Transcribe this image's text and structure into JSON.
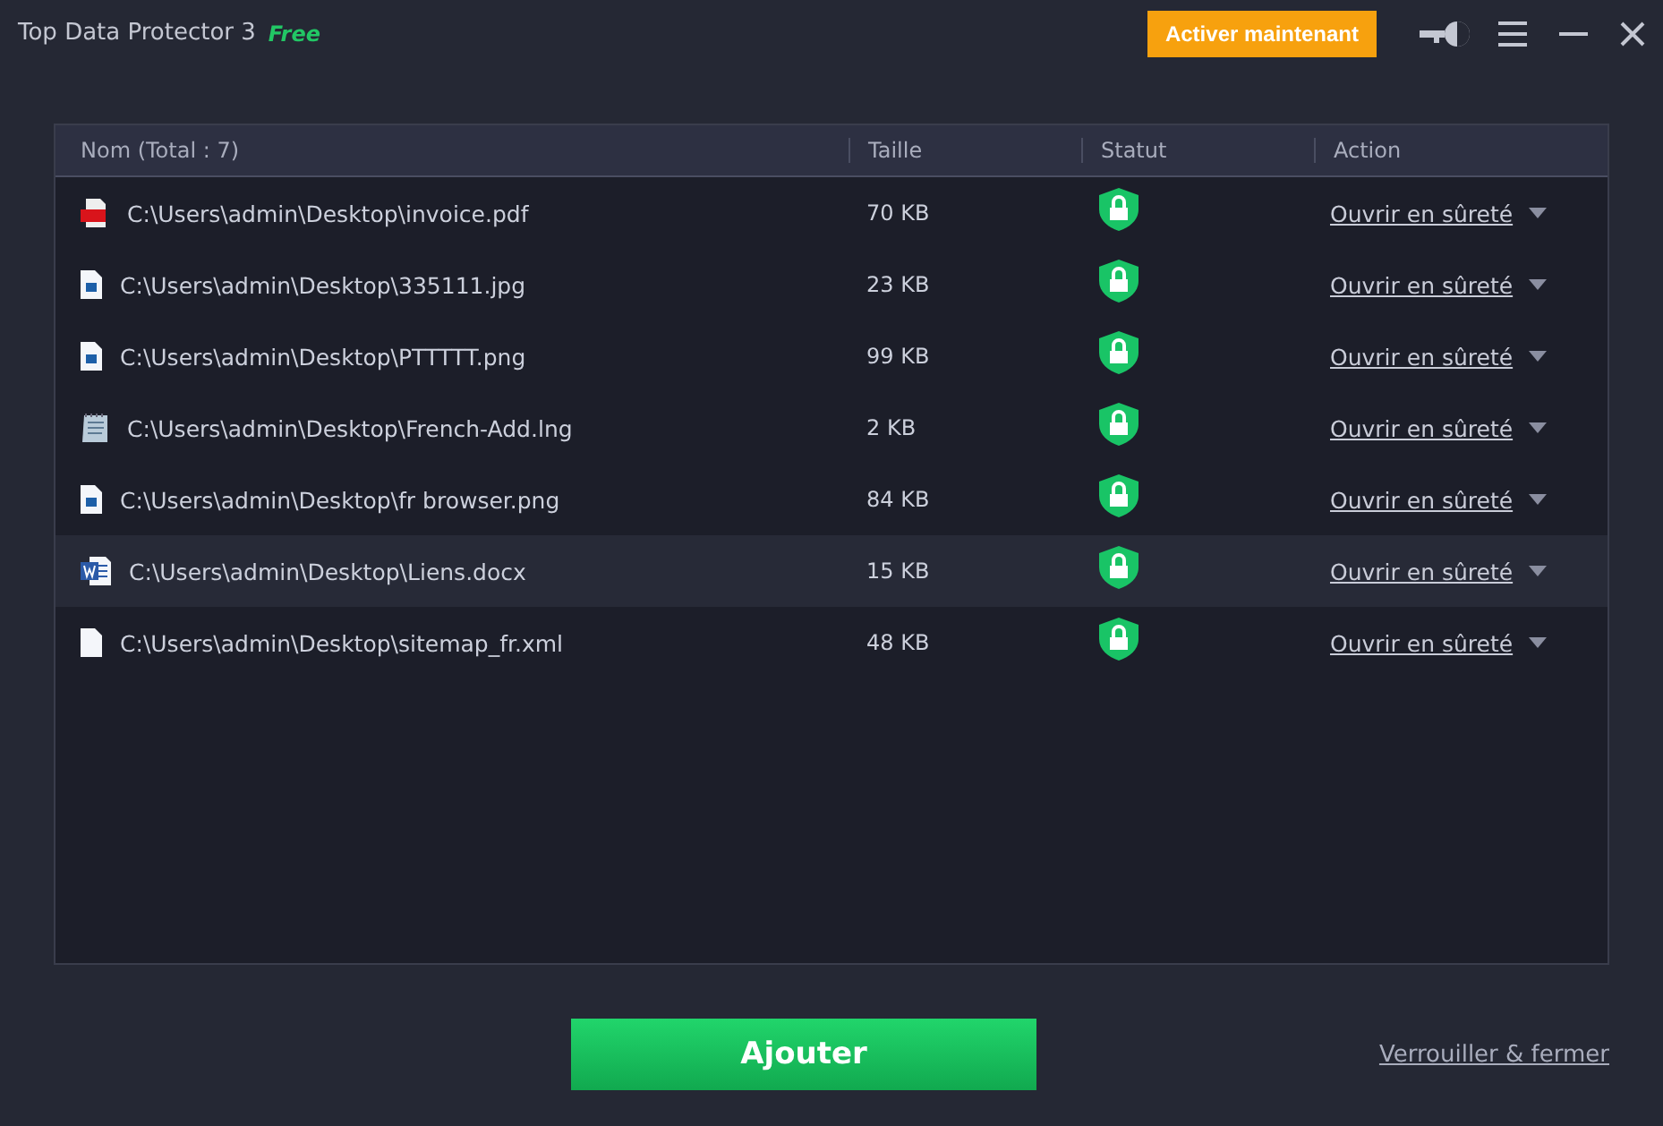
{
  "window": {
    "title": "Top Data Protector 3",
    "edition": "Free"
  },
  "toolbar": {
    "activate_button": "Activer maintenant"
  },
  "table": {
    "columns": [
      "Nom (Total : 7)",
      "Taille",
      "Statut",
      "Action"
    ],
    "rows": [
      {
        "kind": "pdf",
        "path": "C:\\Users\\admin\\Desktop\\invoice.pdf",
        "size": "70 KB",
        "locked": true,
        "action": "Ouvrir en sûreté",
        "selected": false
      },
      {
        "kind": "image",
        "path": "C:\\Users\\admin\\Desktop\\335111.jpg",
        "size": "23 KB",
        "locked": true,
        "action": "Ouvrir en sûreté",
        "selected": false
      },
      {
        "kind": "image",
        "path": "C:\\Users\\admin\\Desktop\\PTTTTT.png",
        "size": "99 KB",
        "locked": true,
        "action": "Ouvrir en sûreté",
        "selected": false
      },
      {
        "kind": "notepad",
        "path": "C:\\Users\\admin\\Desktop\\French-Add.lng",
        "size": "2 KB",
        "locked": true,
        "action": "Ouvrir en sûreté",
        "selected": false
      },
      {
        "kind": "image",
        "path": "C:\\Users\\admin\\Desktop\\fr browser.png",
        "size": "84 KB",
        "locked": true,
        "action": "Ouvrir en sûreté",
        "selected": false
      },
      {
        "kind": "word",
        "path": "C:\\Users\\admin\\Desktop\\Liens.docx",
        "size": "15 KB",
        "locked": true,
        "action": "Ouvrir en sûreté",
        "selected": true
      },
      {
        "kind": "blank",
        "path": "C:\\Users\\admin\\Desktop\\sitemap_fr.xml",
        "size": "48 KB",
        "locked": true,
        "action": "Ouvrir en sûreté",
        "selected": false
      }
    ]
  },
  "footer": {
    "add_button": "Ajouter",
    "lock_link": "Verrouiller & fermer"
  }
}
